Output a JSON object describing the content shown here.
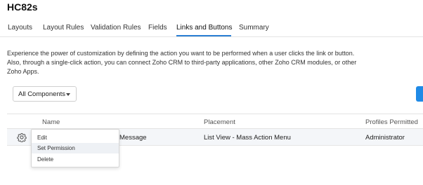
{
  "page": {
    "title": "HC82s"
  },
  "tabs": [
    {
      "label": "Layouts"
    },
    {
      "label": "Layout Rules"
    },
    {
      "label": "Validation Rules"
    },
    {
      "label": "Fields"
    },
    {
      "label": "Links and Buttons",
      "active": true
    },
    {
      "label": "Summary"
    }
  ],
  "description": {
    "line1": "Experience the power of customization by defining the action you want to be performed when a user clicks the link or button.",
    "line2": "Also, through a single-click action, you can connect Zoho CRM to third-party applications, other Zoho CRM modules, or other",
    "line3": "Zoho Apps."
  },
  "filter": {
    "selected": "All Components"
  },
  "table": {
    "headers": {
      "name": "Name",
      "placement": "Placement",
      "profiles": "Profiles Permitted"
    },
    "rows": [
      {
        "name": "Message",
        "placement": "List View - Mass Action Menu",
        "profiles": "Administrator"
      }
    ]
  },
  "context_menu": {
    "items": [
      {
        "label": "Edit"
      },
      {
        "label": "Set Permission",
        "highlighted": true
      },
      {
        "label": "Delete"
      }
    ]
  },
  "colors": {
    "accent": "#2a7fd4",
    "button": "#1f8ae6",
    "row_bg": "#f4f6f9"
  },
  "icons": {
    "row_action": "gear-icon",
    "dropdown": "chevron-down-icon"
  }
}
